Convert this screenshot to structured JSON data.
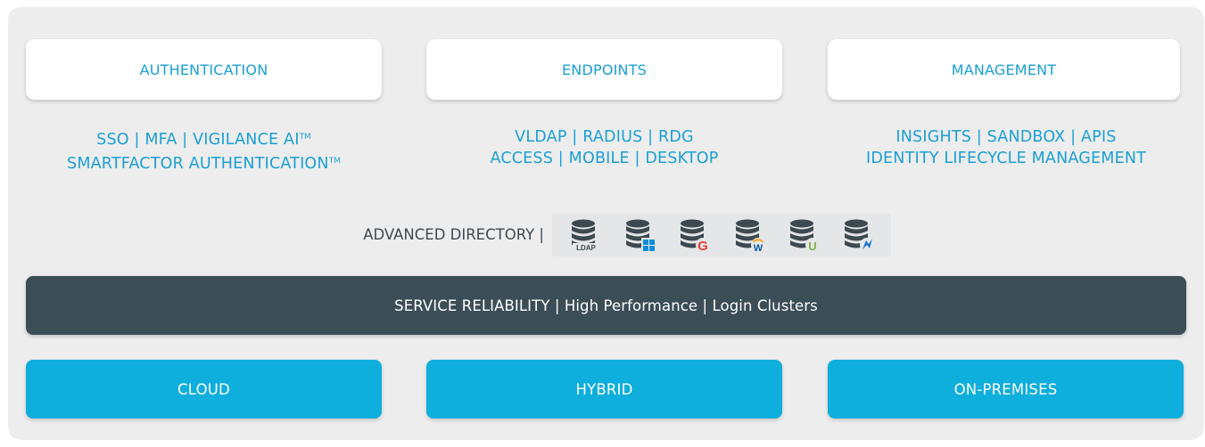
{
  "categories": [
    {
      "label": "AUTHENTICATION"
    },
    {
      "label": "ENDPOINTS"
    },
    {
      "label": "MANAGEMENT"
    }
  ],
  "features": [
    {
      "line1": "SSO | MFA | VIGILANCE AI",
      "line1_tm": "TM",
      "line2": "SMARTFACTOR AUTHENTICATION",
      "line2_tm": "TM"
    },
    {
      "line1": "VLDAP | RADIUS | RDG",
      "line2": "ACCESS | MOBILE | DESKTOP"
    },
    {
      "line1": "INSIGHTS | SANDBOX | APIS",
      "line2": "IDENTITY LIFECYCLE MANAGEMENT"
    }
  ],
  "directory": {
    "label": "ADVANCED DIRECTORY |",
    "icons": [
      {
        "name": "ldap-database-icon",
        "badge_text": "LDAP"
      },
      {
        "name": "windows-database-icon"
      },
      {
        "name": "google-database-icon",
        "badge_text": "G"
      },
      {
        "name": "workday-database-icon",
        "badge_text": "W"
      },
      {
        "name": "upload-database-icon",
        "badge_text": "U"
      },
      {
        "name": "okta-database-icon"
      }
    ]
  },
  "reliability": {
    "label": "SERVICE RELIABILITY | High Performance | Login Clusters"
  },
  "deployments": [
    {
      "label": "CLOUD"
    },
    {
      "label": "HYBRID"
    },
    {
      "label": "ON-PREMISES"
    }
  ],
  "colors": {
    "accent_blue": "#1aa0d4",
    "deploy_blue": "#0eaedd",
    "dark_bar": "#3b4e58",
    "db_gray": "#3d4950",
    "panel_bg": "#ededee"
  }
}
